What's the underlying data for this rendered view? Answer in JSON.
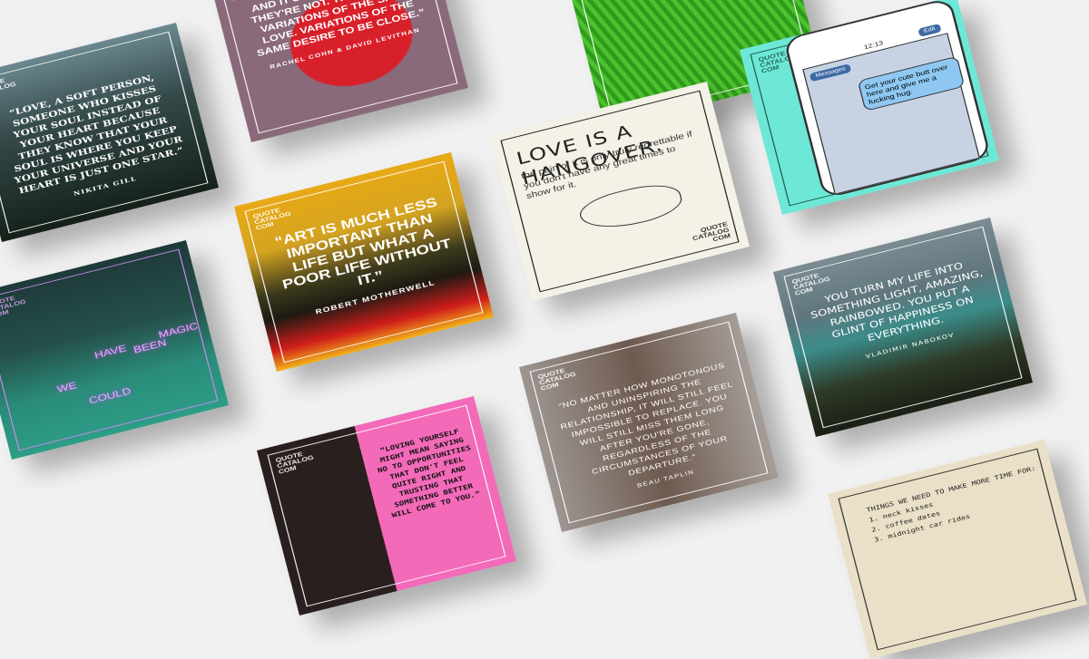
{
  "brand": "QUOTE CATALOG COM",
  "cards": {
    "soft_person": {
      "quote": "“Love, a soft person, someone who kisses your soul instead of your heart because they know that your soul is where you keep your universe and your heart is just one star.”",
      "author": "Nikita Gill"
    },
    "same_love": {
      "quote": "“It's built on friendship and it's being different. They're not. They're just variations of the same love. Variations of the same desire to be close.”",
      "author": "Rachel Cohn & David Levithan"
    },
    "art": {
      "quote": "“Art is much less important than life but what a poor life without it.”",
      "author": "Robert Motherwell"
    },
    "hangover": {
      "title": "LOVE IS A HANGOVER.",
      "subtitle": "the pain of it is only truly regrettable if you don't have any great times to show for it."
    },
    "phone": {
      "time": "12:13",
      "back_button": "Messages",
      "edit_button": "Edit",
      "message": "Get your cute butt over here and give me a fucking hug."
    },
    "neon": {
      "words": [
        "WE",
        "COULD",
        "HAVE",
        "BEEN",
        "MAGIC"
      ]
    },
    "loving_yourself": {
      "quote": "“Loving yourself might mean saying no to opportunities that don't feel quite right and trusting that something better will come to you.”"
    },
    "monotonous": {
      "quote": "“No matter how monotonous and uninspiring the relationship, it will still feel impossible to replace. You will still miss them long after you're gone, regardless of the circumstances of your departure.”",
      "author": "Beau Taplin"
    },
    "waterfall": {
      "quote": "You turn my life into something light, amazing, rainbowed. You put a glint of happiness on everything.",
      "author": "Vladimir Nabokov"
    },
    "typewriter": {
      "title": "THINGS WE NEED TO MAKE MORE TIME FOR:",
      "items": [
        "1. neck kisses",
        "2. coffee dates",
        "3. midnight car rides"
      ]
    }
  }
}
